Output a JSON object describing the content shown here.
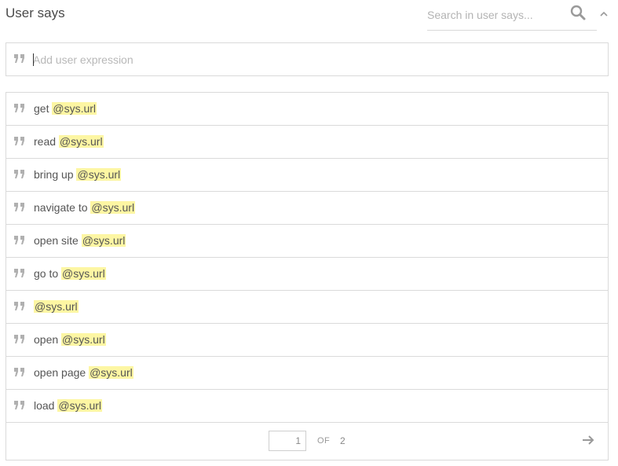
{
  "header": {
    "title": "User says",
    "search_placeholder": "Search in user says..."
  },
  "icons": {
    "search": "search-icon",
    "collapse": "chevron-up-icon",
    "quote": "quote-icon",
    "next": "arrow-right-icon"
  },
  "add_expression": {
    "placeholder": "Add user expression",
    "value": ""
  },
  "expressions": [
    {
      "prefix": "get ",
      "entity": "@sys.url"
    },
    {
      "prefix": "read ",
      "entity": "@sys.url"
    },
    {
      "prefix": "bring up ",
      "entity": "@sys.url"
    },
    {
      "prefix": "navigate to ",
      "entity": "@sys.url"
    },
    {
      "prefix": "open site ",
      "entity": "@sys.url"
    },
    {
      "prefix": "go to ",
      "entity": "@sys.url"
    },
    {
      "prefix": "",
      "entity": "@sys.url"
    },
    {
      "prefix": "open ",
      "entity": "@sys.url"
    },
    {
      "prefix": "open page ",
      "entity": "@sys.url"
    },
    {
      "prefix": "load ",
      "entity": "@sys.url"
    }
  ],
  "pagination": {
    "current_page": "1",
    "of_label": "OF",
    "total_pages": "2"
  },
  "colors": {
    "entity_highlight": "#fdf6a3",
    "border": "#dadada",
    "icon": "#b0b0b0"
  }
}
